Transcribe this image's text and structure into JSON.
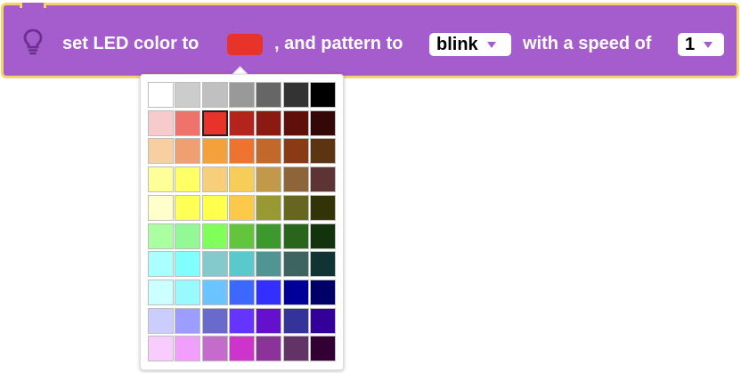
{
  "block": {
    "text_set_led": "set LED color to",
    "text_pattern": ", and pattern to",
    "text_speed": "with a speed of",
    "selected_color": "#e8332a",
    "pattern_value": "blink",
    "speed_value": "1",
    "block_color": "#a55ccd",
    "outline_color": "#f6d26b",
    "icon": "lightbulb-icon"
  },
  "palette": {
    "selected_index": 9,
    "colors": [
      [
        "#ffffff",
        "#cccccc",
        "#c0c0c0",
        "#999999",
        "#666666",
        "#333333",
        "#000000"
      ],
      [
        "#f7cacb",
        "#ef736c",
        "#e8332a",
        "#b4241c",
        "#8b1a13",
        "#5f100b",
        "#330806"
      ],
      [
        "#f7cfa0",
        "#f0a070",
        "#f4a13c",
        "#ef7330",
        "#c2682b",
        "#8a3b14",
        "#5c3411"
      ],
      [
        "#ffff99",
        "#ffff66",
        "#f7ce79",
        "#f7cd5a",
        "#c2994b",
        "#8e653b",
        "#5e3333"
      ],
      [
        "#ffffcc",
        "#ffff55",
        "#ffff4d",
        "#fcc94b",
        "#999933",
        "#666620",
        "#333308"
      ],
      [
        "#aaffa0",
        "#92f996",
        "#80ff5a",
        "#62c53b",
        "#3d992e",
        "#27661b",
        "#12330b"
      ],
      [
        "#aaffff",
        "#80ffff",
        "#84c9cc",
        "#5ac9cc",
        "#519494",
        "#3d6461",
        "#123333"
      ],
      [
        "#ccffff",
        "#98f9ff",
        "#6bc4ff",
        "#3d68ff",
        "#3330ff",
        "#000099",
        "#000066"
      ],
      [
        "#cccdff",
        "#9d9dff",
        "#6a69cc",
        "#6634ff",
        "#6510cc",
        "#333399",
        "#330099"
      ],
      [
        "#f9ccff",
        "#f19eff",
        "#c46bcc",
        "#cc34cc",
        "#8c3399",
        "#613366",
        "#330033"
      ]
    ]
  }
}
